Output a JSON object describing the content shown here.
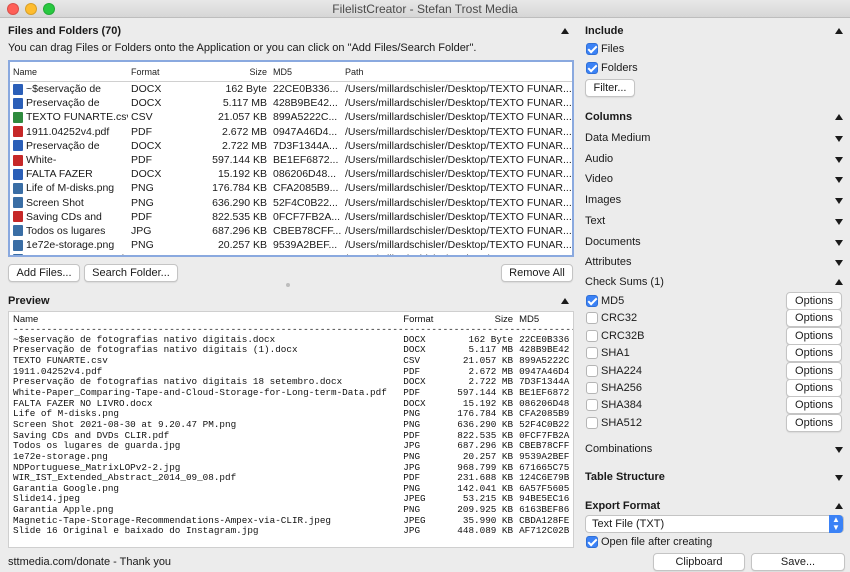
{
  "window": {
    "title": "FilelistCreator - Stefan Trost Media"
  },
  "colors": {
    "close": "#ff5f57",
    "minimize": "#febc2e",
    "zoom": "#28c840",
    "accent": "#3b82f6"
  },
  "files_panel": {
    "title": "Files and Folders (70)",
    "hint": "You can drag Files or Folders onto the Application or you can click on \"Add Files/Search Folder\".",
    "columns": [
      "Name",
      "Format",
      "Size",
      "MD5",
      "Path"
    ],
    "rows": [
      {
        "icon": "word-doc-icon",
        "color": "#2b5fb8",
        "name": "~$eservação de",
        "format": "DOCX",
        "size": "162 Byte",
        "md5": "22CE0B336...",
        "path": "/Users/millardschisler/Desktop/TEXTO FUNAR..."
      },
      {
        "icon": "word-doc-icon",
        "color": "#2b5fb8",
        "name": "Preservação de",
        "format": "DOCX",
        "size": "5.117 MB",
        "md5": "428B9BE42...",
        "path": "/Users/millardschisler/Desktop/TEXTO FUNAR..."
      },
      {
        "icon": "spreadsheet-icon",
        "color": "#2e8b3e",
        "name": "TEXTO FUNARTE.csv",
        "format": "CSV",
        "size": "21.057 KB",
        "md5": "899A5222C...",
        "path": "/Users/millardschisler/Desktop/TEXTO FUNAR..."
      },
      {
        "icon": "pdf-icon",
        "color": "#c62828",
        "name": "1911.04252v4.pdf",
        "format": "PDF",
        "size": "2.672 MB",
        "md5": "0947A46D4...",
        "path": "/Users/millardschisler/Desktop/TEXTO FUNAR..."
      },
      {
        "icon": "word-doc-icon",
        "color": "#2b5fb8",
        "name": "Preservação de",
        "format": "DOCX",
        "size": "2.722 MB",
        "md5": "7D3F1344A...",
        "path": "/Users/millardschisler/Desktop/TEXTO FUNAR..."
      },
      {
        "icon": "pdf-icon",
        "color": "#c62828",
        "name": "White-",
        "format": "PDF",
        "size": "597.144 KB",
        "md5": "BE1EF6872...",
        "path": "/Users/millardschisler/Desktop/TEXTO FUNAR..."
      },
      {
        "icon": "word-doc-icon",
        "color": "#2b5fb8",
        "name": "FALTA FAZER",
        "format": "DOCX",
        "size": "15.192 KB",
        "md5": "086206D48...",
        "path": "/Users/millardschisler/Desktop/TEXTO FUNAR..."
      },
      {
        "icon": "image-icon",
        "color": "#3a6ea5",
        "name": "Life of M-disks.png",
        "format": "PNG",
        "size": "176.784 KB",
        "md5": "CFA2085B9...",
        "path": "/Users/millardschisler/Desktop/TEXTO FUNAR..."
      },
      {
        "icon": "image-icon",
        "color": "#3a6ea5",
        "name": "Screen Shot",
        "format": "PNG",
        "size": "636.290 KB",
        "md5": "52F4C0B22...",
        "path": "/Users/millardschisler/Desktop/TEXTO FUNAR..."
      },
      {
        "icon": "pdf-icon",
        "color": "#c62828",
        "name": "Saving CDs and",
        "format": "PDF",
        "size": "822.535 KB",
        "md5": "0FCF7FB2A...",
        "path": "/Users/millardschisler/Desktop/TEXTO FUNAR..."
      },
      {
        "icon": "image-icon",
        "color": "#3a6ea5",
        "name": "Todos os lugares",
        "format": "JPG",
        "size": "687.296 KB",
        "md5": "CBEB78CFF...",
        "path": "/Users/millardschisler/Desktop/TEXTO FUNAR..."
      },
      {
        "icon": "image-icon",
        "color": "#3a6ea5",
        "name": "1e72e-storage.png",
        "format": "PNG",
        "size": "20.257 KB",
        "md5": "9539A2BEF...",
        "path": "/Users/millardschisler/Desktop/TEXTO FUNAR..."
      },
      {
        "icon": "image-icon",
        "color": "#3a6ea5",
        "name": "NDPortuguese_Matrix",
        "format": "JPG",
        "size": "968.799 KB",
        "md5": "671665C75...",
        "path": "/Users/millardschisler/Desktop/TEXTO FUNAR..."
      }
    ],
    "add_files_label": "Add Files...",
    "search_folder_label": "Search Folder...",
    "remove_all_label": "Remove All"
  },
  "preview_panel": {
    "title": "Preview",
    "columns": [
      "Name",
      "Format",
      "Size",
      "MD5"
    ],
    "separator": "------------------------------------------------------------------------------------------------------------------------",
    "rows": [
      {
        "name": "~$eservação de fotografias nativo digitais.docx",
        "format": "DOCX",
        "size": "162 Byte",
        "md5": "22CE0B336"
      },
      {
        "name": "Preservação de fotografias nativo digitais (1).docx",
        "format": "DOCX",
        "size": "5.117 MB",
        "md5": "428B9BE42"
      },
      {
        "name": "TEXTO FUNARTE.csv",
        "format": "CSV",
        "size": "21.057 KB",
        "md5": "899A5222C"
      },
      {
        "name": "1911.04252v4.pdf",
        "format": "PDF",
        "size": "2.672 MB",
        "md5": "0947A46D4"
      },
      {
        "name": "Preservação de fotografias nativo digitais 18 setembro.docx",
        "format": "DOCX",
        "size": "2.722 MB",
        "md5": "7D3F1344A"
      },
      {
        "name": "White-Paper_Comparing-Tape-and-Cloud-Storage-for-Long-term-Data.pdf",
        "format": "PDF",
        "size": "597.144 KB",
        "md5": "BE1EF6872"
      },
      {
        "name": "FALTA FAZER NO LIVRO.docx",
        "format": "DOCX",
        "size": "15.192 KB",
        "md5": "086206D48"
      },
      {
        "name": "Life of M-disks.png",
        "format": "PNG",
        "size": "176.784 KB",
        "md5": "CFA2085B9"
      },
      {
        "name": "Screen Shot 2021-08-30 at 9.20.47 PM.png",
        "format": "PNG",
        "size": "636.290 KB",
        "md5": "52F4C0B22"
      },
      {
        "name": "Saving CDs and DVDs CLIR.pdf",
        "format": "PDF",
        "size": "822.535 KB",
        "md5": "0FCF7FB2A"
      },
      {
        "name": "Todos os lugares de guarda.jpg",
        "format": "JPG",
        "size": "687.296 KB",
        "md5": "CBEB78CFF"
      },
      {
        "name": "1e72e-storage.png",
        "format": "PNG",
        "size": "20.257 KB",
        "md5": "9539A2BEF"
      },
      {
        "name": "NDPortuguese_MatrixLOPv2-2.jpg",
        "format": "JPG",
        "size": "968.799 KB",
        "md5": "671665C75"
      },
      {
        "name": "WIR_IST_Extended_Abstract_2014_09_08.pdf",
        "format": "PDF",
        "size": "231.688 KB",
        "md5": "124C6E79B"
      },
      {
        "name": "Garantia Google.png",
        "format": "PNG",
        "size": "142.041 KB",
        "md5": "6A57F5605"
      },
      {
        "name": "Slide14.jpeg",
        "format": "JPEG",
        "size": "53.215 KB",
        "md5": "94BE5EC16"
      },
      {
        "name": "Garantia Apple.png",
        "format": "PNG",
        "size": "209.925 KB",
        "md5": "6163BEF86"
      },
      {
        "name": "Magnetic-Tape-Storage-Recommendations-Ampex-via-CLIR.jpeg",
        "format": "JPEG",
        "size": "35.990 KB",
        "md5": "CBDA128FE"
      },
      {
        "name": "Slide 16 Original e baixado do Instagram.jpg",
        "format": "JPG",
        "size": "448.089 KB",
        "md5": "AF712C02B"
      }
    ]
  },
  "status_bar": {
    "text": "sttmedia.com/donate - Thank you"
  },
  "include": {
    "title": "Include",
    "files_label": "Files",
    "folders_label": "Folders",
    "filter_label": "Filter..."
  },
  "columns_section": {
    "title": "Columns",
    "items": [
      "Data Medium",
      "Audio",
      "Video",
      "Images",
      "Text",
      "Documents",
      "Attributes"
    ]
  },
  "checksums": {
    "title": "Check Sums (1)",
    "items": [
      {
        "label": "MD5",
        "checked": true
      },
      {
        "label": "CRC32",
        "checked": false
      },
      {
        "label": "CRC32B",
        "checked": false
      },
      {
        "label": "SHA1",
        "checked": false
      },
      {
        "label": "SHA224",
        "checked": false
      },
      {
        "label": "SHA256",
        "checked": false
      },
      {
        "label": "SHA384",
        "checked": false
      },
      {
        "label": "SHA512",
        "checked": false
      }
    ],
    "options_label": "Options"
  },
  "combinations": {
    "title": "Combinations"
  },
  "table_structure": {
    "title": "Table Structure"
  },
  "export": {
    "title": "Export Format",
    "format_value": "Text File (TXT)",
    "open_after_label": "Open file after creating",
    "clipboard_label": "Clipboard",
    "save_label": "Save..."
  }
}
